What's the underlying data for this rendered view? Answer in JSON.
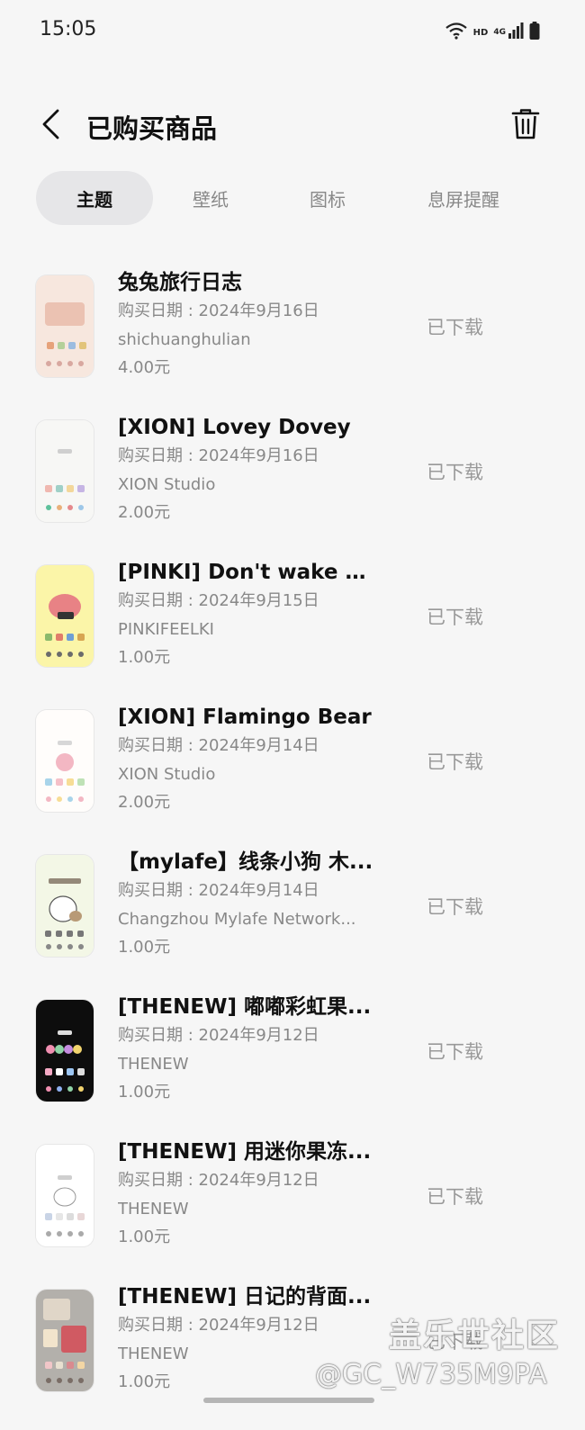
{
  "status_bar": {
    "time": "15:05",
    "wifi_icon": "wifi-icon",
    "hd_label": "HD",
    "network_label": "4G",
    "signal_icon": "signal-icon",
    "battery_icon": "battery-icon"
  },
  "header": {
    "title": "已购买商品",
    "back_icon": "back-arrow-icon",
    "delete_icon": "trash-icon"
  },
  "tabs": [
    {
      "label": "主题",
      "active": true
    },
    {
      "label": "壁纸",
      "active": false
    },
    {
      "label": "图标",
      "active": false
    },
    {
      "label": "息屏提醒",
      "active": false
    }
  ],
  "items": [
    {
      "title": "兔兔旅行日志",
      "date": "购买日期 : 2024年9月16日",
      "author": "shichuanghulian",
      "price": "4.00元",
      "status": "已下载",
      "thumb_bg": "#f7e7de",
      "thumb_accent": "#e7b9a6"
    },
    {
      "title": "[XION] Lovey Dovey",
      "date": "购买日期 : 2024年9月16日",
      "author": "XION Studio",
      "price": "2.00元",
      "status": "已下载",
      "thumb_bg": "#f7f7f5",
      "thumb_accent": "#9fd0c7"
    },
    {
      "title": "[PINKI] Don't wake m...",
      "date": "购买日期 : 2024年9月15日",
      "author": "PINKIFEELKI",
      "price": "1.00元",
      "status": "已下载",
      "thumb_bg": "#fbf5a8",
      "thumb_accent": "#e46d7f"
    },
    {
      "title": "[XION] Flamingo Bear",
      "date": "购买日期 : 2024年9月14日",
      "author": "XION Studio",
      "price": "2.00元",
      "status": "已下载",
      "thumb_bg": "#fffdfb",
      "thumb_accent": "#f3b7c3"
    },
    {
      "title": "【mylafe】线条小狗 木...",
      "date": "购买日期 : 2024年9月14日",
      "author": "Changzhou Mylafe Network...",
      "price": "1.00元",
      "status": "已下载",
      "thumb_bg": "#f3f7e6",
      "thumb_accent": "#b89a76"
    },
    {
      "title": "[THENEW] 嘟嘟彩虹果...",
      "date": "购买日期 : 2024年9月12日",
      "author": "THENEW",
      "price": "1.00元",
      "status": "已下载",
      "thumb_bg": "#0d0d0d",
      "thumb_accent": "#c58de0"
    },
    {
      "title": "[THENEW] 用迷你果冻...",
      "date": "购买日期 : 2024年9月12日",
      "author": "THENEW",
      "price": "1.00元",
      "status": "已下载",
      "thumb_bg": "#ffffff",
      "thumb_accent": "#c9d4e6"
    },
    {
      "title": "[THENEW] 日记的背面...",
      "date": "购买日期 : 2024年9月12日",
      "author": "THENEW",
      "price": "1.00元",
      "status": "已下载",
      "thumb_bg": "#b3b0ab",
      "thumb_accent": "#d05a62"
    }
  ],
  "watermark": {
    "line1": "盖乐世社区",
    "line2": "@GC_W735M9PA"
  }
}
